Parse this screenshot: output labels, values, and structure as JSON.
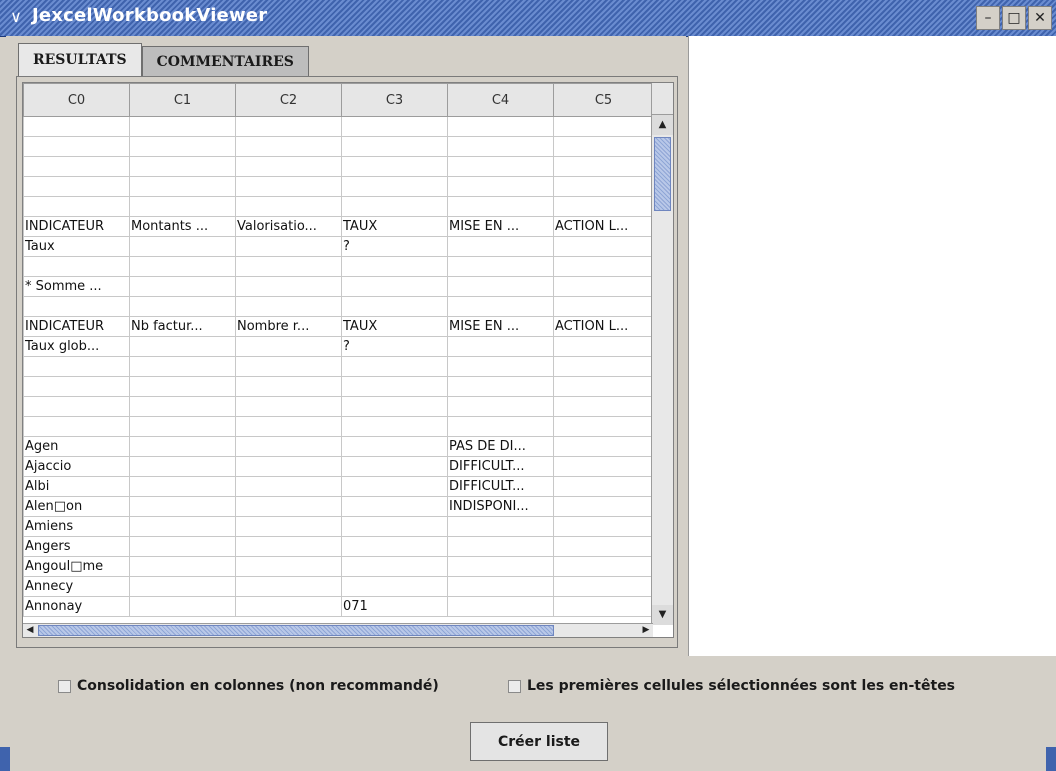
{
  "window": {
    "title": "JexcelWorkbookViewer",
    "menu_glyph": "∨",
    "btn_min": "–",
    "btn_max": "□",
    "btn_close": "✕",
    "icon_names": [
      "chevron-down-icon",
      "minimize-icon",
      "maximize-icon",
      "close-icon"
    ]
  },
  "tabs": [
    {
      "label": "RESULTATS",
      "active": true
    },
    {
      "label": "COMMENTAIRES",
      "active": false
    }
  ],
  "grid": {
    "columns": [
      "C0",
      "C1",
      "C2",
      "C3",
      "C4",
      "C5"
    ],
    "rows": [
      [
        "",
        "",
        "",
        "",
        "",
        ""
      ],
      [
        "",
        "",
        "",
        "",
        "",
        ""
      ],
      [
        "",
        "",
        "",
        "",
        "",
        ""
      ],
      [
        "",
        "",
        "",
        "",
        "",
        ""
      ],
      [
        "",
        "",
        "",
        "",
        "",
        ""
      ],
      [
        "INDICATEUR",
        "Montants ...",
        "Valorisatio...",
        "TAUX",
        "MISE EN ...",
        "ACTION L..."
      ],
      [
        "Taux",
        "",
        "",
        "?",
        "",
        ""
      ],
      [
        "",
        "",
        "",
        "",
        "",
        ""
      ],
      [
        "* Somme ...",
        "",
        "",
        "",
        "",
        ""
      ],
      [
        "",
        "",
        "",
        "",
        "",
        ""
      ],
      [
        "INDICATEUR",
        "Nb factur...",
        "Nombre r...",
        "TAUX",
        "MISE EN ...",
        "ACTION L..."
      ],
      [
        "Taux glob...",
        "",
        "",
        "?",
        "",
        ""
      ],
      [
        "",
        "",
        "",
        "",
        "",
        ""
      ],
      [
        "",
        "",
        "",
        "",
        "",
        ""
      ],
      [
        "",
        "",
        "",
        "",
        "",
        ""
      ],
      [
        "",
        "",
        "",
        "",
        "",
        ""
      ],
      [
        "Agen",
        "",
        "",
        "",
        "PAS DE DI...",
        ""
      ],
      [
        "Ajaccio",
        "",
        "",
        "",
        "DIFFICULT...",
        ""
      ],
      [
        "Albi",
        "",
        "",
        "",
        "DIFFICULT...",
        ""
      ],
      [
        "Alen□on",
        "",
        "",
        "",
        "INDISPONI...",
        ""
      ],
      [
        "Amiens",
        "",
        "",
        "",
        "",
        ""
      ],
      [
        "Angers",
        "",
        "",
        "",
        "",
        ""
      ],
      [
        "Angoul□me",
        "",
        "",
        "",
        "",
        ""
      ],
      [
        "Annecy",
        "",
        "",
        "",
        "",
        ""
      ],
      [
        "Annonay",
        "",
        "",
        "071",
        "",
        ""
      ]
    ],
    "scroll_up": "▲",
    "scroll_down": "▼",
    "scroll_left": "◀",
    "scroll_right": "▶"
  },
  "options": {
    "consolidation_label": "Consolidation en colonnes (non recommandé)",
    "consolidation_checked": false,
    "headers_label": "Les premières cellules sélectionnées sont les en-têtes",
    "headers_checked": false
  },
  "create_button": "Créer liste",
  "colors": {
    "title_bar": "#3f63ad",
    "panel_bg": "#d4d0c8",
    "scroll_thumb": "#8fa6d6"
  }
}
